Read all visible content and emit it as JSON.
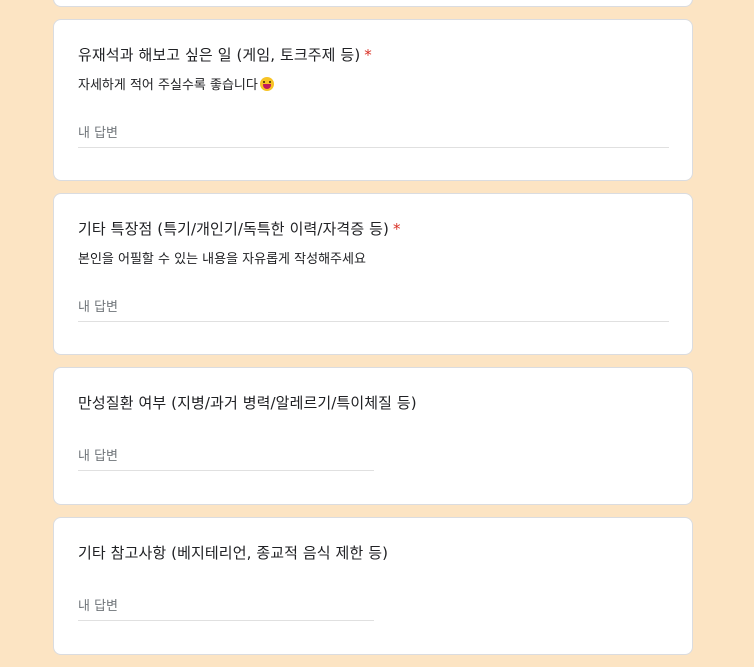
{
  "questions": [
    {
      "title": "유재석과 해보고 싶은 일 (게임, 토크주제 등)",
      "required_mark": "*",
      "description": "자세하게 적어 주실수록 좋습니다",
      "emoji": "grinning-face-with-tongue-icon",
      "placeholder": "내 답변"
    },
    {
      "title": "기타 특장점 (특기/개인기/독특한 이력/자격증 등)",
      "required_mark": "*",
      "description": "본인을 어필할 수 있는 내용을 자유롭게 작성해주세요",
      "placeholder": "내 답변"
    },
    {
      "title": "만성질환 여부 (지병/과거 병력/알레르기/특이체질 등)",
      "placeholder": "내 답변"
    },
    {
      "title": "기타 참고사항 (베지테리언, 종교적 음식 제한 등)",
      "placeholder": "내 답변"
    }
  ],
  "colors": {
    "background": "#fce4c3",
    "card": "#ffffff",
    "required": "#d93025",
    "placeholder": "#70757a"
  }
}
